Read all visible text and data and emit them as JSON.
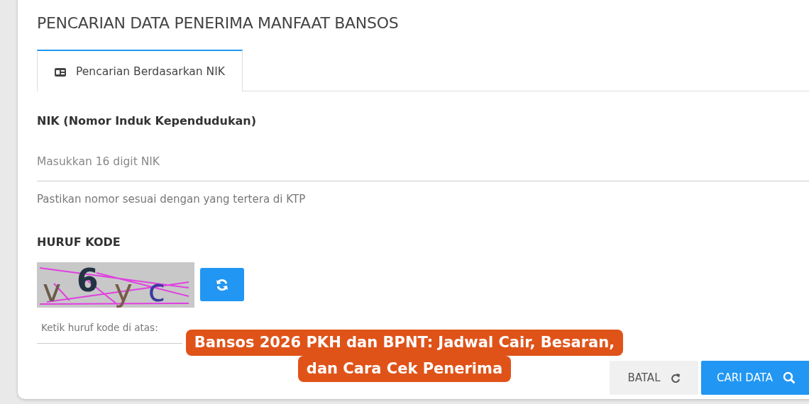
{
  "page_title": "PENCARIAN DATA PENERIMA MANFAAT BANSOS",
  "tabs": [
    {
      "label": "Pencarian Berdasarkan NIK",
      "selected": true
    }
  ],
  "nik_field": {
    "label": "NIK (Nomor Induk Kependudukan)",
    "placeholder": "Masukkan 16 digit NIK",
    "help": "Pastikan nomor sesuai dengan yang tertera di KTP"
  },
  "captcha": {
    "label": "HURUF KODE",
    "characters": [
      "v",
      "6",
      "y",
      "c"
    ],
    "placeholder": "Ketik huruf kode di atas:"
  },
  "buttons": [
    {
      "label": "BATAL",
      "kind": "secondary"
    },
    {
      "label": "CARI DATA",
      "kind": "primary"
    }
  ],
  "caption_banner": [
    "Bansos 2026 PKH dan BPNT: Jadwal Cair, Besaran,",
    "dan Cara Cek Penerima"
  ]
}
